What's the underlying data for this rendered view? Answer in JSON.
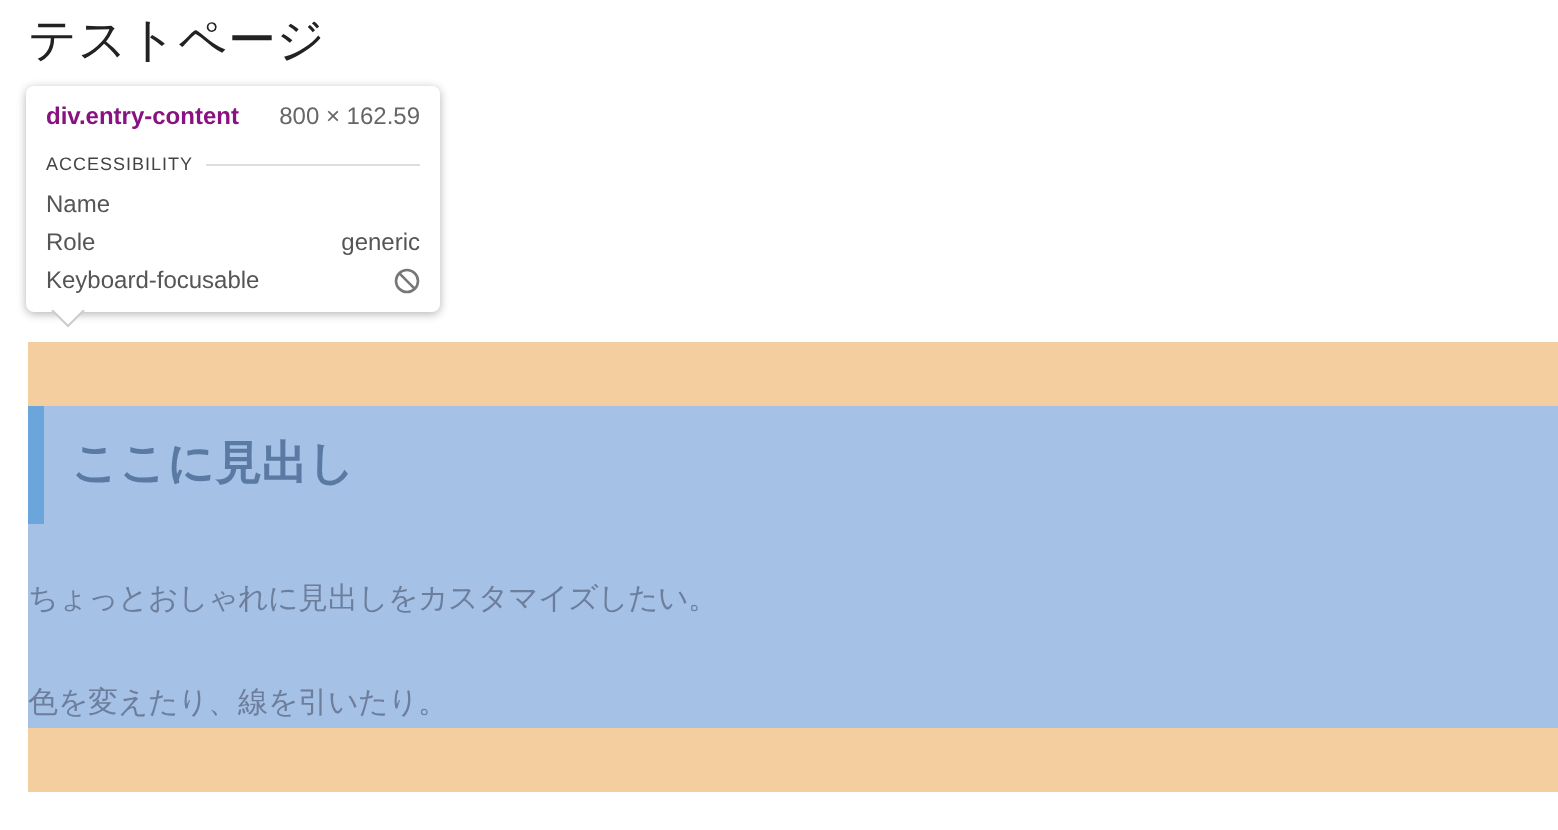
{
  "page_title": "テストページ",
  "content": {
    "heading": "ここに見出し",
    "paragraphs": [
      "ちょっとおしゃれに見出しをカスタマイズしたい。",
      "色を変えたり、線を引いたり。"
    ]
  },
  "inspector_tooltip": {
    "element": "div.entry-content",
    "size": "800 × 162.59",
    "section": "ACCESSIBILITY",
    "properties": [
      {
        "label": "Name",
        "kind": "text"
      },
      {
        "label": "Role",
        "value": "generic",
        "kind": "text"
      },
      {
        "label": "Keyboard-focusable",
        "kind": "not-allowed"
      }
    ]
  }
}
